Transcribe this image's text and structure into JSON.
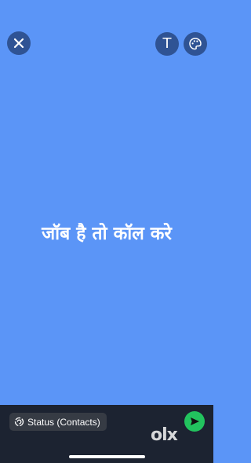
{
  "status_text": "जॉब है तो कॉल करे",
  "toolbar": {
    "close_icon": "close-icon",
    "text_tool_label": "T",
    "palette_icon": "palette-icon"
  },
  "footer": {
    "audience_label": "Status (Contacts)",
    "audience_icon": "status-icon",
    "send_icon": "send-icon"
  },
  "watermark": "olx",
  "colors": {
    "background": "#5b95f7",
    "button_bg": "#2f5394",
    "footer_bg": "#1c2331",
    "send_button": "#22c35e"
  }
}
